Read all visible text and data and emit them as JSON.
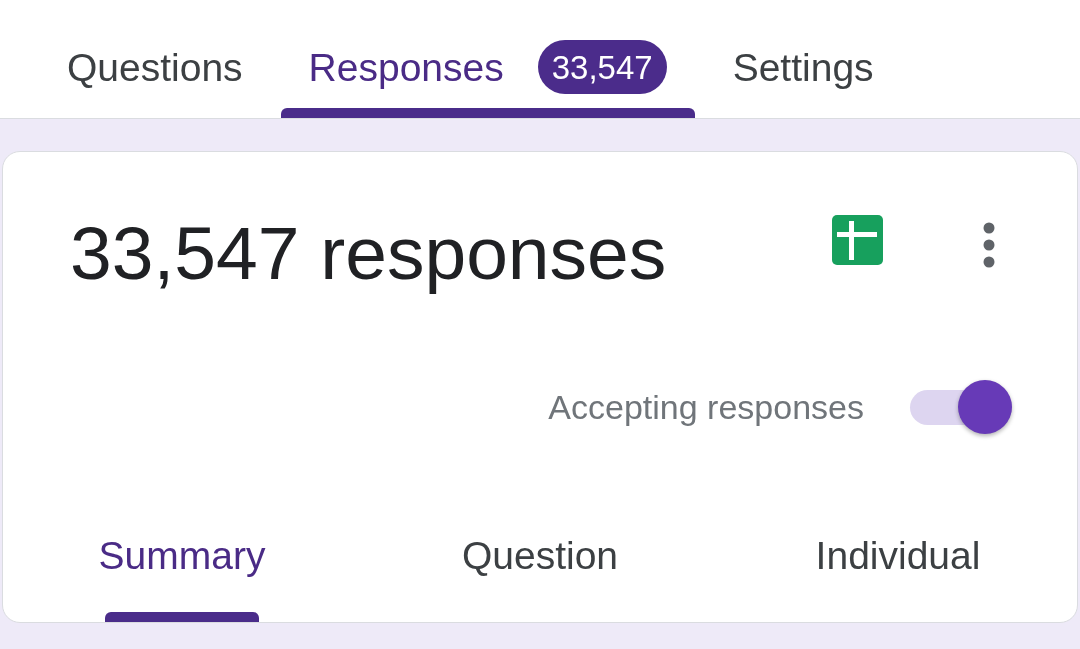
{
  "tabs": [
    {
      "label": "Questions",
      "selected": false
    },
    {
      "label": "Responses",
      "selected": true,
      "badge": "33,547"
    },
    {
      "label": "Settings",
      "selected": false
    }
  ],
  "summary_card": {
    "title": "33,547 responses",
    "accepting_responses": {
      "label": "Accepting responses",
      "on": true
    },
    "view_tabs": [
      {
        "label": "Summary",
        "selected": true
      },
      {
        "label": "Question",
        "selected": false
      },
      {
        "label": "Individual",
        "selected": false
      }
    ]
  }
}
